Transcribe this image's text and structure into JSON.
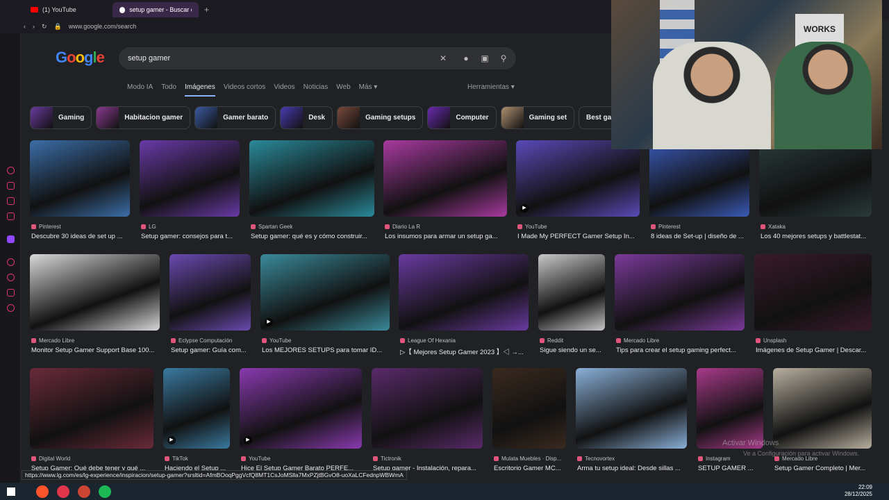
{
  "browser": {
    "tabs": [
      {
        "label": "(1) YouTube",
        "active": false
      },
      {
        "label": "setup gamer - Buscar con",
        "active": true
      }
    ],
    "url": "www.google.com/search",
    "new_tab": "+"
  },
  "google": {
    "logo": "Google",
    "query": "setup gamer",
    "tabs": [
      "Modo IA",
      "Todo",
      "Imágenes",
      "Videos cortos",
      "Videos",
      "Noticias",
      "Web",
      "Más ▾"
    ],
    "active_tab": "Imágenes",
    "tools": "Herramientas ▾",
    "chips": [
      "Gaming",
      "Habitacion gamer",
      "Gamer barato",
      "Desk",
      "Gaming setups",
      "Computer",
      "Gaming set",
      "Best gaming pc"
    ]
  },
  "results": [
    {
      "source": "Pinterest",
      "title": "Descubre 30 ideas de set up ...",
      "video": false,
      "color": "#3b6ea8"
    },
    {
      "source": "LG",
      "title": "Setup gamer: consejos para t...",
      "video": false,
      "color": "#6a3aa8"
    },
    {
      "source": "Spartan Geek",
      "title": "Setup gamer: qué es y cómo construir...",
      "video": false,
      "color": "#2a8a9a"
    },
    {
      "source": "Diario La R",
      "title": "Los insumos para armar un setup ga...",
      "video": false,
      "color": "#a83aa0"
    },
    {
      "source": "YouTube",
      "title": "I Made My PERFECT Gamer Setup In...",
      "video": true,
      "color": "#5a4ab8"
    },
    {
      "source": "Pinterest",
      "title": "8 ideas de Set-up | diseño de ...",
      "video": false,
      "color": "#3a5ab8"
    },
    {
      "source": "Xataka",
      "title": "Los 40 mejores setups y battlestat...",
      "video": false,
      "color": "#2a3a3a"
    },
    {
      "source": "Mercado Libre",
      "title": "Monitor Setup Gamer Support Base 100...",
      "video": false,
      "color": "#d8d8d8"
    },
    {
      "source": "Eclypse Computación",
      "title": "Setup gamer: Guía com...",
      "video": false,
      "color": "#6a4ab0"
    },
    {
      "source": "YouTube",
      "title": "Los MEJORES SETUPS para tomar ID...",
      "video": true,
      "color": "#3a8a9a"
    },
    {
      "source": "League Of Hexania",
      "title": "▷【 Mejores Setup Gamer 2023 】◁ →...",
      "video": false,
      "color": "#6a3aa0"
    },
    {
      "source": "Reddit",
      "title": "Sigue siendo un se...",
      "video": false,
      "color": "#c8c8c8"
    },
    {
      "source": "Mercado Libre",
      "title": "Tips para crear el setup gaming perfect...",
      "video": false,
      "color": "#7a3a9a"
    },
    {
      "source": "Unsplash",
      "title": "Imágenes de Setup Gamer | Descar...",
      "video": false,
      "color": "#3a1a2a"
    },
    {
      "source": "Digital World",
      "title": "Setup Gamer: Qué debe tener y qué ...",
      "video": false,
      "color": "#6a2a3a"
    },
    {
      "source": "TikTok",
      "title": "Haciendo el Setup ...",
      "video": true,
      "color": "#3a7aa0"
    },
    {
      "source": "YouTube",
      "title": "Hice El Setup Gamer Barato PERFE...",
      "video": true,
      "color": "#8a3ab0"
    },
    {
      "source": "Tictronik",
      "title": "Setup gamer - Instalación, repara...",
      "video": false,
      "color": "#5a2a6a"
    },
    {
      "source": "Mulata Muebles · Disp...",
      "title": "Escritorio Gamer MC...",
      "video": false,
      "color": "#3a2a20"
    },
    {
      "source": "Tecnovortex",
      "title": "Arma tu setup ideal: Desde sillas ...",
      "video": false,
      "color": "#8ab0d8"
    },
    {
      "source": "Instagram",
      "title": "SETUP GAMER ...",
      "video": false,
      "color": "#a83a8a"
    },
    {
      "source": "Mercado Libre",
      "title": "Setup Gamer Completo | Mer...",
      "video": false,
      "color": "#b8b0a0"
    }
  ],
  "status_url": "https://www.lg.com/es/lg-experience/inspiracion/setup-gamer?srsltid=AfmBOoqPggVcfQ8MT1CsJoMSlla7MxPZjtBGvO8-uoXaLCFednpWBWmA",
  "watermark": {
    "line1": "Activar Windows",
    "line2": "Ve a Configuración para activar Windows."
  },
  "clock": {
    "time": "22:09",
    "date": "28/12/2025"
  }
}
